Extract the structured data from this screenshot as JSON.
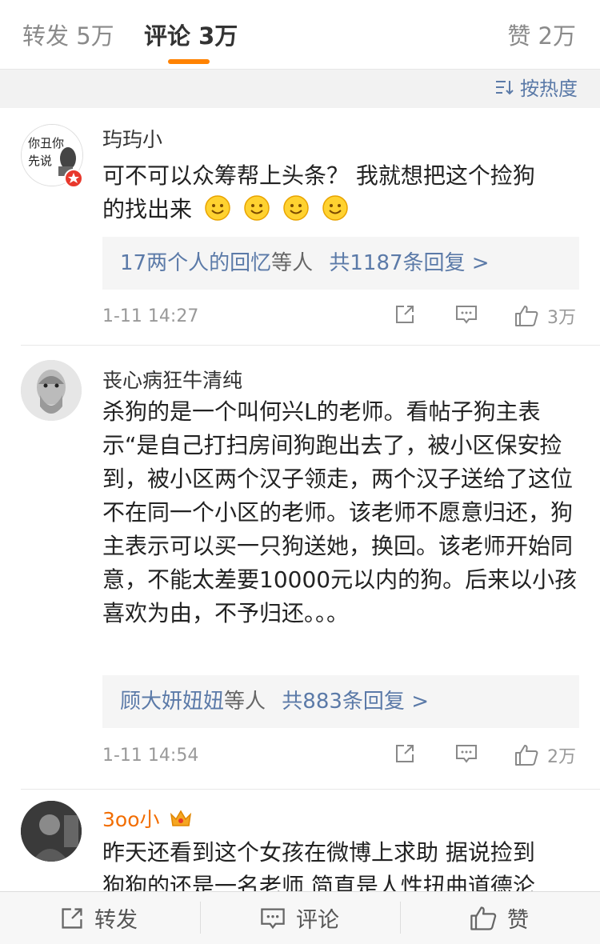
{
  "tabs": [
    {
      "label": "转发 5万"
    },
    {
      "label": "评论 3万"
    },
    {
      "label": "赞 2万"
    }
  ],
  "sort": {
    "label": "按热度"
  },
  "comments": [
    {
      "name": "玙玙小",
      "avatar_text": "你丑你先说",
      "text_line1": "可不可以众筹帮上头条？ 我就想把这个捡狗",
      "text_line2": "的找出来",
      "replies_names": "17两个人的回忆",
      "replies_suffix": "等人",
      "replies_count": "共1187条回复 >",
      "time": "1-11 14:27",
      "likes": "3万"
    },
    {
      "name": "丧心病狂牛清纯",
      "text": "杀狗的是一个叫何兴L的老师。看帖子狗主表示“是自己打扫房间狗跑出去了，被小区保安捡到，被小区两个汉子领走，两个汉子送给了这位不在同一个小区的老师。该老师不愿意归还，狗主表示可以买一只狗送她，换回。该老师开始同意，不能太差要10000元以内的狗。后来以小孩喜欢为由，不予归还。。。",
      "replies_names": "顾大妍妞妞",
      "replies_suffix": "等人",
      "replies_count": "共883条回复 >",
      "time": "1-11 14:54",
      "likes": "2万"
    },
    {
      "name": "3oo小",
      "text_line1": "昨天还看到这个女孩在微博上求助 据说捡到",
      "text_line2": "狗狗的还是一名老师 简直是人性扭曲道德沦"
    }
  ],
  "bottom": {
    "repost": "转发",
    "comment": "评论",
    "like": "赞"
  },
  "colors": {
    "accent": "#ff8200",
    "link": "#5b7aa8",
    "vip_gold": "#f5a623"
  }
}
